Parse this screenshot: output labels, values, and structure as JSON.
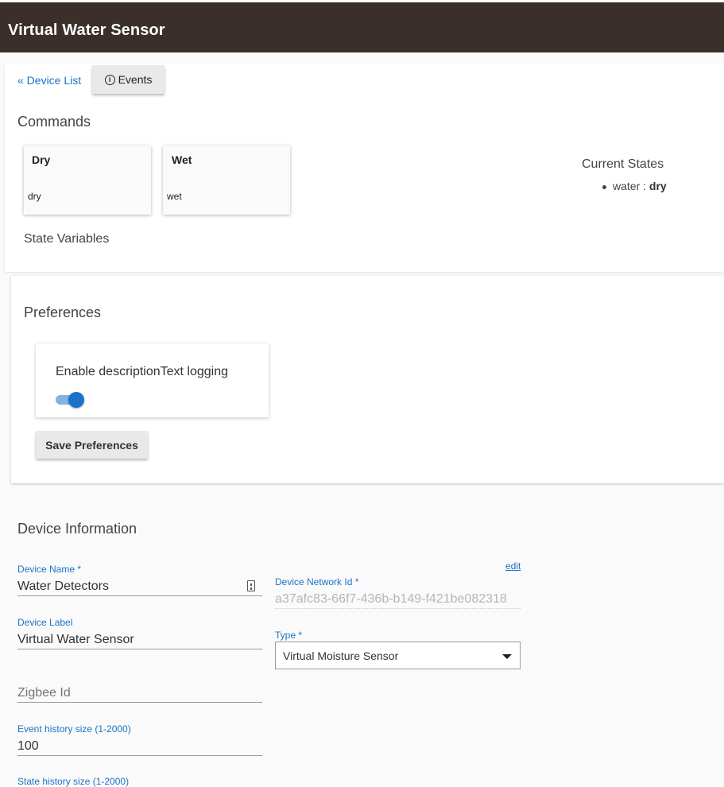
{
  "header": {
    "title": "Virtual Water Sensor"
  },
  "nav": {
    "device_list_label": "« Device List",
    "events_label": "Events"
  },
  "commands": {
    "heading": "Commands",
    "items": [
      {
        "title": "Dry",
        "sub": "dry"
      },
      {
        "title": "Wet",
        "sub": "wet"
      }
    ]
  },
  "state_variables": {
    "heading": "State Variables"
  },
  "current_states": {
    "heading": "Current States",
    "items": [
      {
        "name": "water",
        "sep": " : ",
        "value": "dry"
      }
    ]
  },
  "preferences": {
    "heading": "Preferences",
    "items": [
      {
        "label": "Enable descriptionText logging",
        "enabled": true
      }
    ],
    "save_label": "Save Preferences"
  },
  "device_info": {
    "heading": "Device Information",
    "edit_label": "edit",
    "device_name": {
      "label": "Device Name *",
      "value": "Water Detectors"
    },
    "device_network_id": {
      "label": "Device Network Id *",
      "value": "a37afc83-66f7-436b-b149-f421be082318"
    },
    "device_label": {
      "label": "Device Label",
      "value": "Virtual Water Sensor"
    },
    "type": {
      "label": "Type *",
      "value": "Virtual Moisture Sensor"
    },
    "zigbee_id": {
      "placeholder": "Zigbee Id"
    },
    "event_history": {
      "label": "Event history size (1-2000)",
      "value": "100"
    },
    "state_history": {
      "label": "State history size (1-2000)"
    }
  },
  "colors": {
    "header_bg": "#3a2f2b",
    "accent": "#1a73c8"
  }
}
